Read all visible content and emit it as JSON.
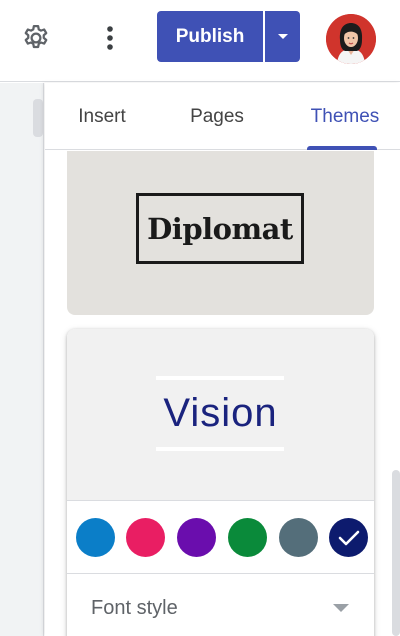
{
  "toolbar": {
    "settings_icon": "gear-icon",
    "more_icon": "more-vert-icon",
    "publish_label": "Publish",
    "publish_dropdown_icon": "caret-down-icon",
    "avatar": "user-avatar"
  },
  "tabs": [
    {
      "label": "Insert",
      "active": false
    },
    {
      "label": "Pages",
      "active": false
    },
    {
      "label": "Themes",
      "active": true
    }
  ],
  "themes": [
    {
      "name": "Diplomat",
      "background": "#e3e1dd",
      "text_color": "#1a1a1a"
    },
    {
      "name": "Vision",
      "selected": true,
      "title_color": "#1a237e",
      "color_swatches": [
        {
          "color": "#0b7ec8",
          "selected": false
        },
        {
          "color": "#e91e63",
          "selected": false
        },
        {
          "color": "#6a0dad",
          "selected": false
        },
        {
          "color": "#0a8a3a",
          "selected": false
        },
        {
          "color": "#546e7a",
          "selected": false
        },
        {
          "color": "#0d1b6e",
          "selected": true
        }
      ],
      "font_style_label": "Font style"
    }
  ],
  "colors": {
    "accent": "#3f51b5",
    "divider": "#dadce0"
  }
}
